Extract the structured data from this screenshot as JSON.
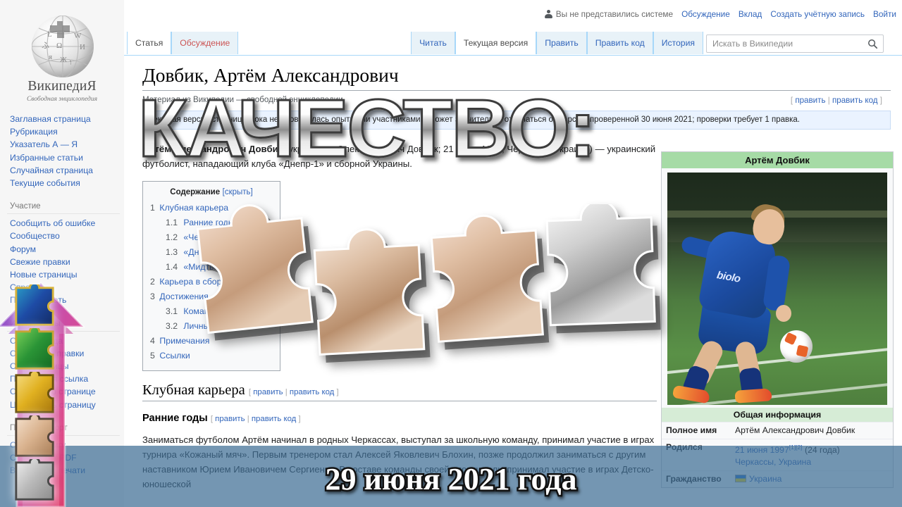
{
  "personal_bar": {
    "anon_label": "Вы не представились системе",
    "links": [
      "Обсуждение",
      "Вклад",
      "Создать учётную запись",
      "Войти"
    ]
  },
  "logo": {
    "title": "ВикипедиЯ",
    "subtitle": "Свободная энциклопедия"
  },
  "search": {
    "placeholder": "Искать в Википедии",
    "value": ""
  },
  "namespace_tabs": [
    {
      "label": "Статья",
      "state": "selected"
    },
    {
      "label": "Обсуждение",
      "state": "new"
    }
  ],
  "view_tabs": [
    {
      "label": "Читать",
      "state": "normal"
    },
    {
      "label": "Текущая версия",
      "state": "selected"
    },
    {
      "label": "Править",
      "state": "normal"
    },
    {
      "label": "Править код",
      "state": "normal"
    },
    {
      "label": "История",
      "state": "normal"
    }
  ],
  "sidebar": {
    "groups": [
      {
        "heading": "",
        "items": [
          "Заглавная страница",
          "Рубрикация",
          "Указатель А — Я",
          "Избранные статьи",
          "Случайная страница",
          "Текущие события"
        ]
      },
      {
        "heading": "Участие",
        "items": [
          "Сообщить об ошибке",
          "Сообщество",
          "Форум",
          "Свежие правки",
          "Новые страницы",
          "Справка",
          "Пожертвовать"
        ]
      },
      {
        "heading": "Инструменты",
        "items": [
          "Ссылки сюда",
          "Связанные правки",
          "Спецстраницы",
          "Постоянная ссылка",
          "Сведения о странице",
          "Цитировать страницу"
        ]
      },
      {
        "heading": "Печать/экспорт",
        "items": [
          "Создать книгу",
          "Скачать как PDF",
          "Версия для печати"
        ]
      }
    ]
  },
  "article": {
    "title": "Довбик, Артём Александрович",
    "site_sub": "Материал из Википедии — свободной энциклопедии",
    "edit_top": {
      "open": "[",
      "edit": "править",
      "pipe": "|",
      "editsource": "править код",
      "close": "]"
    },
    "notice": "Текущая версия страницы пока не проверялась опытными участниками и может значительно отличаться от версии, проверенной 30 июня 2021; проверки требует 1 правка.",
    "notice_link_1": "не проверялась опытными участниками",
    "notice_link_2": "1 правка",
    "lead_bold": "Артём Александрович Довбик",
    "lead_rest": " (укр. Артем Олександрович Довбик; 21 июня 1997, Черкассы, Украина) — украинский футболист, нападающий клуба «Днепр-1» и сборной Украины."
  },
  "toc": {
    "title": "Содержание",
    "toggle": "[скрыть]",
    "entries": [
      {
        "num": "1",
        "label": "Клубная карьера",
        "level": 1
      },
      {
        "num": "1.1",
        "label": "Ранние годы",
        "level": 2
      },
      {
        "num": "1.2",
        "label": "«Черкаський Дніпро»",
        "level": 2
      },
      {
        "num": "1.3",
        "label": "«Днепр»",
        "level": 2
      },
      {
        "num": "1.4",
        "label": "«Мидтьюлланн»",
        "level": 2
      },
      {
        "num": "2",
        "label": "Карьера в сборной",
        "level": 1
      },
      {
        "num": "3",
        "label": "Достижения",
        "level": 1
      },
      {
        "num": "3.1",
        "label": "Командные",
        "level": 2
      },
      {
        "num": "3.2",
        "label": "Личные",
        "level": 2
      },
      {
        "num": "4",
        "label": "Примечания",
        "level": 1
      },
      {
        "num": "5",
        "label": "Ссылки",
        "level": 1
      }
    ]
  },
  "sections": {
    "h2_label": "Клубная карьера",
    "h3_label": "Ранние годы",
    "edit_open": "[",
    "edit": "править",
    "edit_pipe": "|",
    "editsource": "править код",
    "edit_close": "]",
    "paragraph": "Заниматься футболом Артём начинал в родных Черкассах, выступал за школьную команду, принимал участие в играх турнира «Кожаный мяч». Первым тренером стал Алексей Яковлевич Блохин, позже продолжил заниматься с другим наставником Юрием Ивановичем Сергиенко. В составе команды своей спортшколы принимал участие в играх Детско-юношеской"
  },
  "infobox": {
    "header": "Артём Довбик",
    "photo_sponsor": "biolo",
    "section_label": "Общая информация",
    "rows": [
      {
        "key": "Полное имя",
        "value": "Артём Александрович Довбик"
      },
      {
        "key": "Родился",
        "value": "21 июня 1997",
        "sup": "[1][2]",
        "tail": " (24 года)",
        "value2": "Черкассы, Украина"
      },
      {
        "key": "Гражданство",
        "value": "Украина",
        "flag": true
      }
    ]
  },
  "overlay": {
    "title_text": "КАЧЕСТВО:",
    "date_text": "29 июня 2021 года"
  },
  "colors": {
    "link": "#3366bb",
    "new_link": "#cc5555",
    "tab_bg": "#e8f2f8",
    "tab_border": "#a7d7f9",
    "infobox_header": "#a6dba6",
    "infobox_subheader": "#d6ecd6",
    "notice_bg": "#eaf3ff",
    "band": "#3f6e94",
    "puzzle_blue": "#1d3f8f",
    "puzzle_green": "#2d8a35",
    "puzzle_yellow": "#e0b020",
    "puzzle_tan": "#d9b28e",
    "puzzle_silver": "#b9b9b9"
  }
}
